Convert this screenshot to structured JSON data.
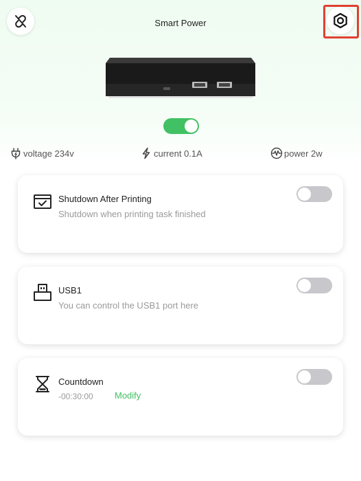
{
  "header": {
    "title": "Smart Power",
    "unlink_icon": "unlink-icon",
    "settings_icon": "hexagon-settings-icon"
  },
  "device": {
    "image": "smart-power-box-image",
    "power_on": true
  },
  "stats": {
    "voltage": "voltage 234v",
    "current": "current 0.1A",
    "power": "power 2w"
  },
  "cards": [
    {
      "icon": "printer-check-icon",
      "title": "Shutdown After Printing",
      "description": "Shutdown when printing task finished",
      "enabled": false
    },
    {
      "icon": "usb-port-icon",
      "title": "USB1",
      "description": "You can control the USB1 port here",
      "enabled": false
    },
    {
      "icon": "hourglass-icon",
      "title": "Countdown",
      "time": "-00:30:00",
      "modify_label": "Modify",
      "enabled": false
    }
  ],
  "colors": {
    "accent": "#41c163",
    "toggle_off": "#c7c7cc",
    "highlight": "#e0402f"
  }
}
